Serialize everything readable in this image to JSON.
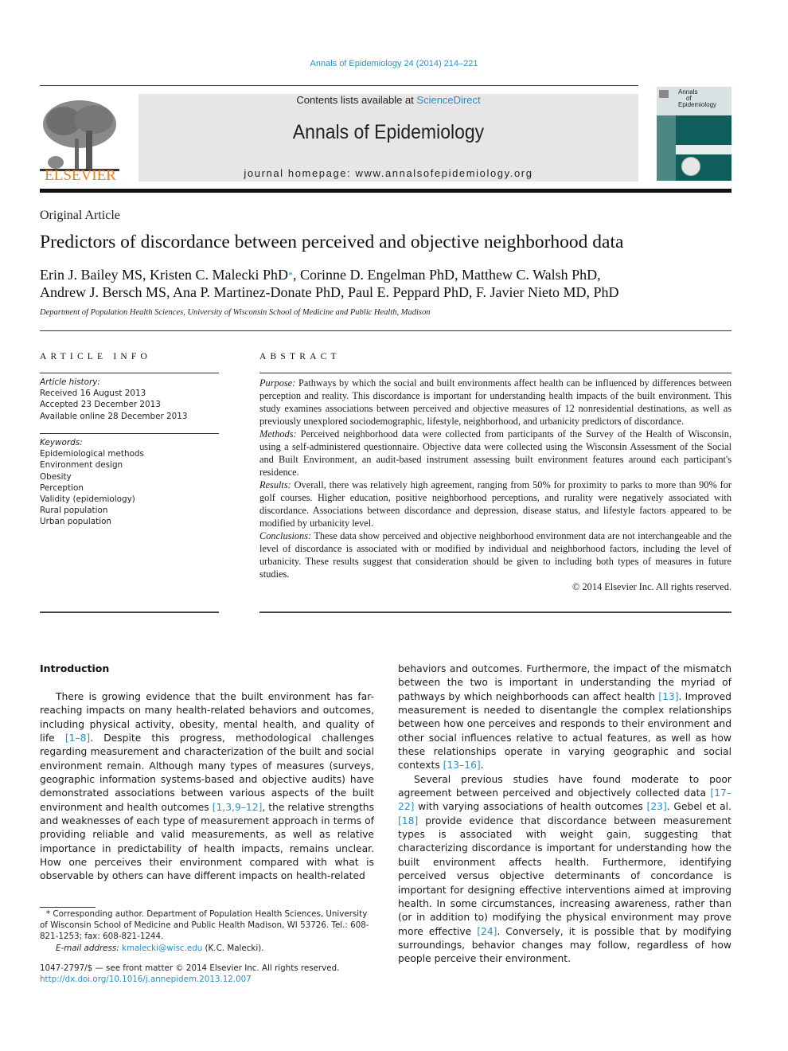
{
  "running_header": "Annals of Epidemiology 24 (2014) 214–221",
  "masthead": {
    "publisher_wordmark": "ELSEVIER",
    "contents_prefix": "Contents lists available at ",
    "contents_link": "ScienceDirect",
    "journal_title": "Annals of Epidemiology",
    "homepage": "journal homepage: www.annalsofepidemiology.org",
    "cover_title_lines": [
      "Annals",
      "of",
      "Epidemiology"
    ]
  },
  "article": {
    "type": "Original Article",
    "title": "Predictors of discordance between perceived and objective neighborhood data",
    "authors_line1_a": "Erin J. Bailey MS, Kristen C. Malecki PhD",
    "corresponding_marker": "*",
    "authors_line1_b": ", Corinne D. Engelman PhD, Matthew C. Walsh PhD,",
    "authors_line2": "Andrew J. Bersch MS, Ana P. Martinez-Donate PhD, Paul E. Peppard PhD, F. Javier Nieto MD, PhD",
    "affiliation": "Department of Population Health Sciences, University of Wisconsin School of Medicine and Public Health, Madison"
  },
  "article_info": {
    "heading": "ARTICLE INFO",
    "history_label": "Article history:",
    "history": [
      "Received 16 August 2013",
      "Accepted 23 December 2013",
      "Available online 28 December 2013"
    ],
    "keywords_label": "Keywords:",
    "keywords": [
      "Epidemiological methods",
      "Environment design",
      "Obesity",
      "Perception",
      "Validity (epidemiology)",
      "Rural population",
      "Urban population"
    ]
  },
  "abstract": {
    "heading": "ABSTRACT",
    "sections": [
      {
        "label": "Purpose:",
        "text": " Pathways by which the social and built environments affect health can be influenced by differences between perception and reality. This discordance is important for understanding health impacts of the built environment. This study examines associations between perceived and objective measures of 12 nonresidential destinations, as well as previously unexplored sociodemographic, lifestyle, neighborhood, and urbanicity predictors of discordance."
      },
      {
        "label": "Methods:",
        "text": " Perceived neighborhood data were collected from participants of the Survey of the Health of Wisconsin, using a self-administered questionnaire. Objective data were collected using the Wisconsin Assessment of the Social and Built Environment, an audit-based instrument assessing built environment features around each participant's residence."
      },
      {
        "label": "Results:",
        "text": " Overall, there was relatively high agreement, ranging from 50% for proximity to parks to more than 90% for golf courses. Higher education, positive neighborhood perceptions, and rurality were negatively associated with discordance. Associations between discordance and depression, disease status, and lifestyle factors appeared to be modified by urbanicity level."
      },
      {
        "label": "Conclusions:",
        "text": " These data show perceived and objective neighborhood environment data are not interchangeable and the level of discordance is associated with or modified by individual and neighborhood factors, including the level of urbanicity. These results suggest that consideration should be given to including both types of measures in future studies."
      }
    ],
    "copyright": "© 2014 Elsevier Inc. All rights reserved."
  },
  "body": {
    "intro_heading": "Introduction",
    "left_p1": [
      {
        "t": "There is growing evidence that the built environment has far-reaching impacts on many health-related behaviors and outcomes, including physical activity, obesity, mental health, and quality of life "
      },
      {
        "ref": "[1–8]"
      },
      {
        "t": ". Despite this progress, methodological challenges regarding measurement and characterization of the built and social environment remain. Although many types of measures (surveys, geographic information systems-based and objective audits) have demonstrated associations between various aspects of the built environment and health outcomes "
      },
      {
        "ref": "[1,3,9–12]"
      },
      {
        "t": ", the relative strengths and weaknesses of each type of measurement approach in terms of providing reliable and valid measurements, as well as relative importance in predictability of health impacts, remains unclear. How one perceives their environment compared with what is observable by others can have different impacts on health-related"
      }
    ],
    "right_p1": [
      {
        "t": "behaviors and outcomes. Furthermore, the impact of the mismatch between the two is important in understanding the myriad of pathways by which neighborhoods can affect health "
      },
      {
        "ref": "[13]"
      },
      {
        "t": ". Improved measurement is needed to disentangle the complex relationships between how one perceives and responds to their environment and other social influences relative to actual features, as well as how these relationships operate in varying geographic and social contexts "
      },
      {
        "ref": "[13–16]"
      },
      {
        "t": "."
      }
    ],
    "right_p2": [
      {
        "t": "Several previous studies have found moderate to poor agreement between perceived and objectively collected data "
      },
      {
        "ref": "[17–22]"
      },
      {
        "t": " with varying associations of health outcomes "
      },
      {
        "ref": "[23]"
      },
      {
        "t": ". Gebel et al. "
      },
      {
        "ref": "[18]"
      },
      {
        "t": " provide evidence that discordance between measurement types is associated with weight gain, suggesting that characterizing discordance is important for understanding how the built environment affects health. Furthermore, identifying perceived versus objective determinants of concordance is important for designing effective interventions aimed at improving health. In some circumstances, increasing awareness, rather than (or in addition to) modifying the physical environment may prove more effective "
      },
      {
        "ref": "[24]"
      },
      {
        "t": ". Conversely, it is possible that by modifying surroundings, behavior changes may follow, regardless of how people perceive their environment."
      }
    ]
  },
  "footnote": {
    "corresponding": "* Corresponding author. Department of Population Health Sciences, University of Wisconsin School of Medicine and Public Health Madison, WI 53726. Tel.: 608-821-1253; fax: 608-821-1244.",
    "email_label": "E-mail address:",
    "email": "kmalecki@wisc.edu",
    "email_suffix": " (K.C. Malecki)."
  },
  "front_matter": {
    "issn_line": "1047-2797/$ — see front matter © 2014 Elsevier Inc. All rights reserved.",
    "doi": "http://dx.doi.org/10.1016/j.annepidem.2013.12.007"
  },
  "colors": {
    "link": "#2a8ec2",
    "elsevier_orange": "#f07d1a",
    "masthead_gray": "#e6e6e6",
    "cover_teal": "#0f5e5c"
  }
}
